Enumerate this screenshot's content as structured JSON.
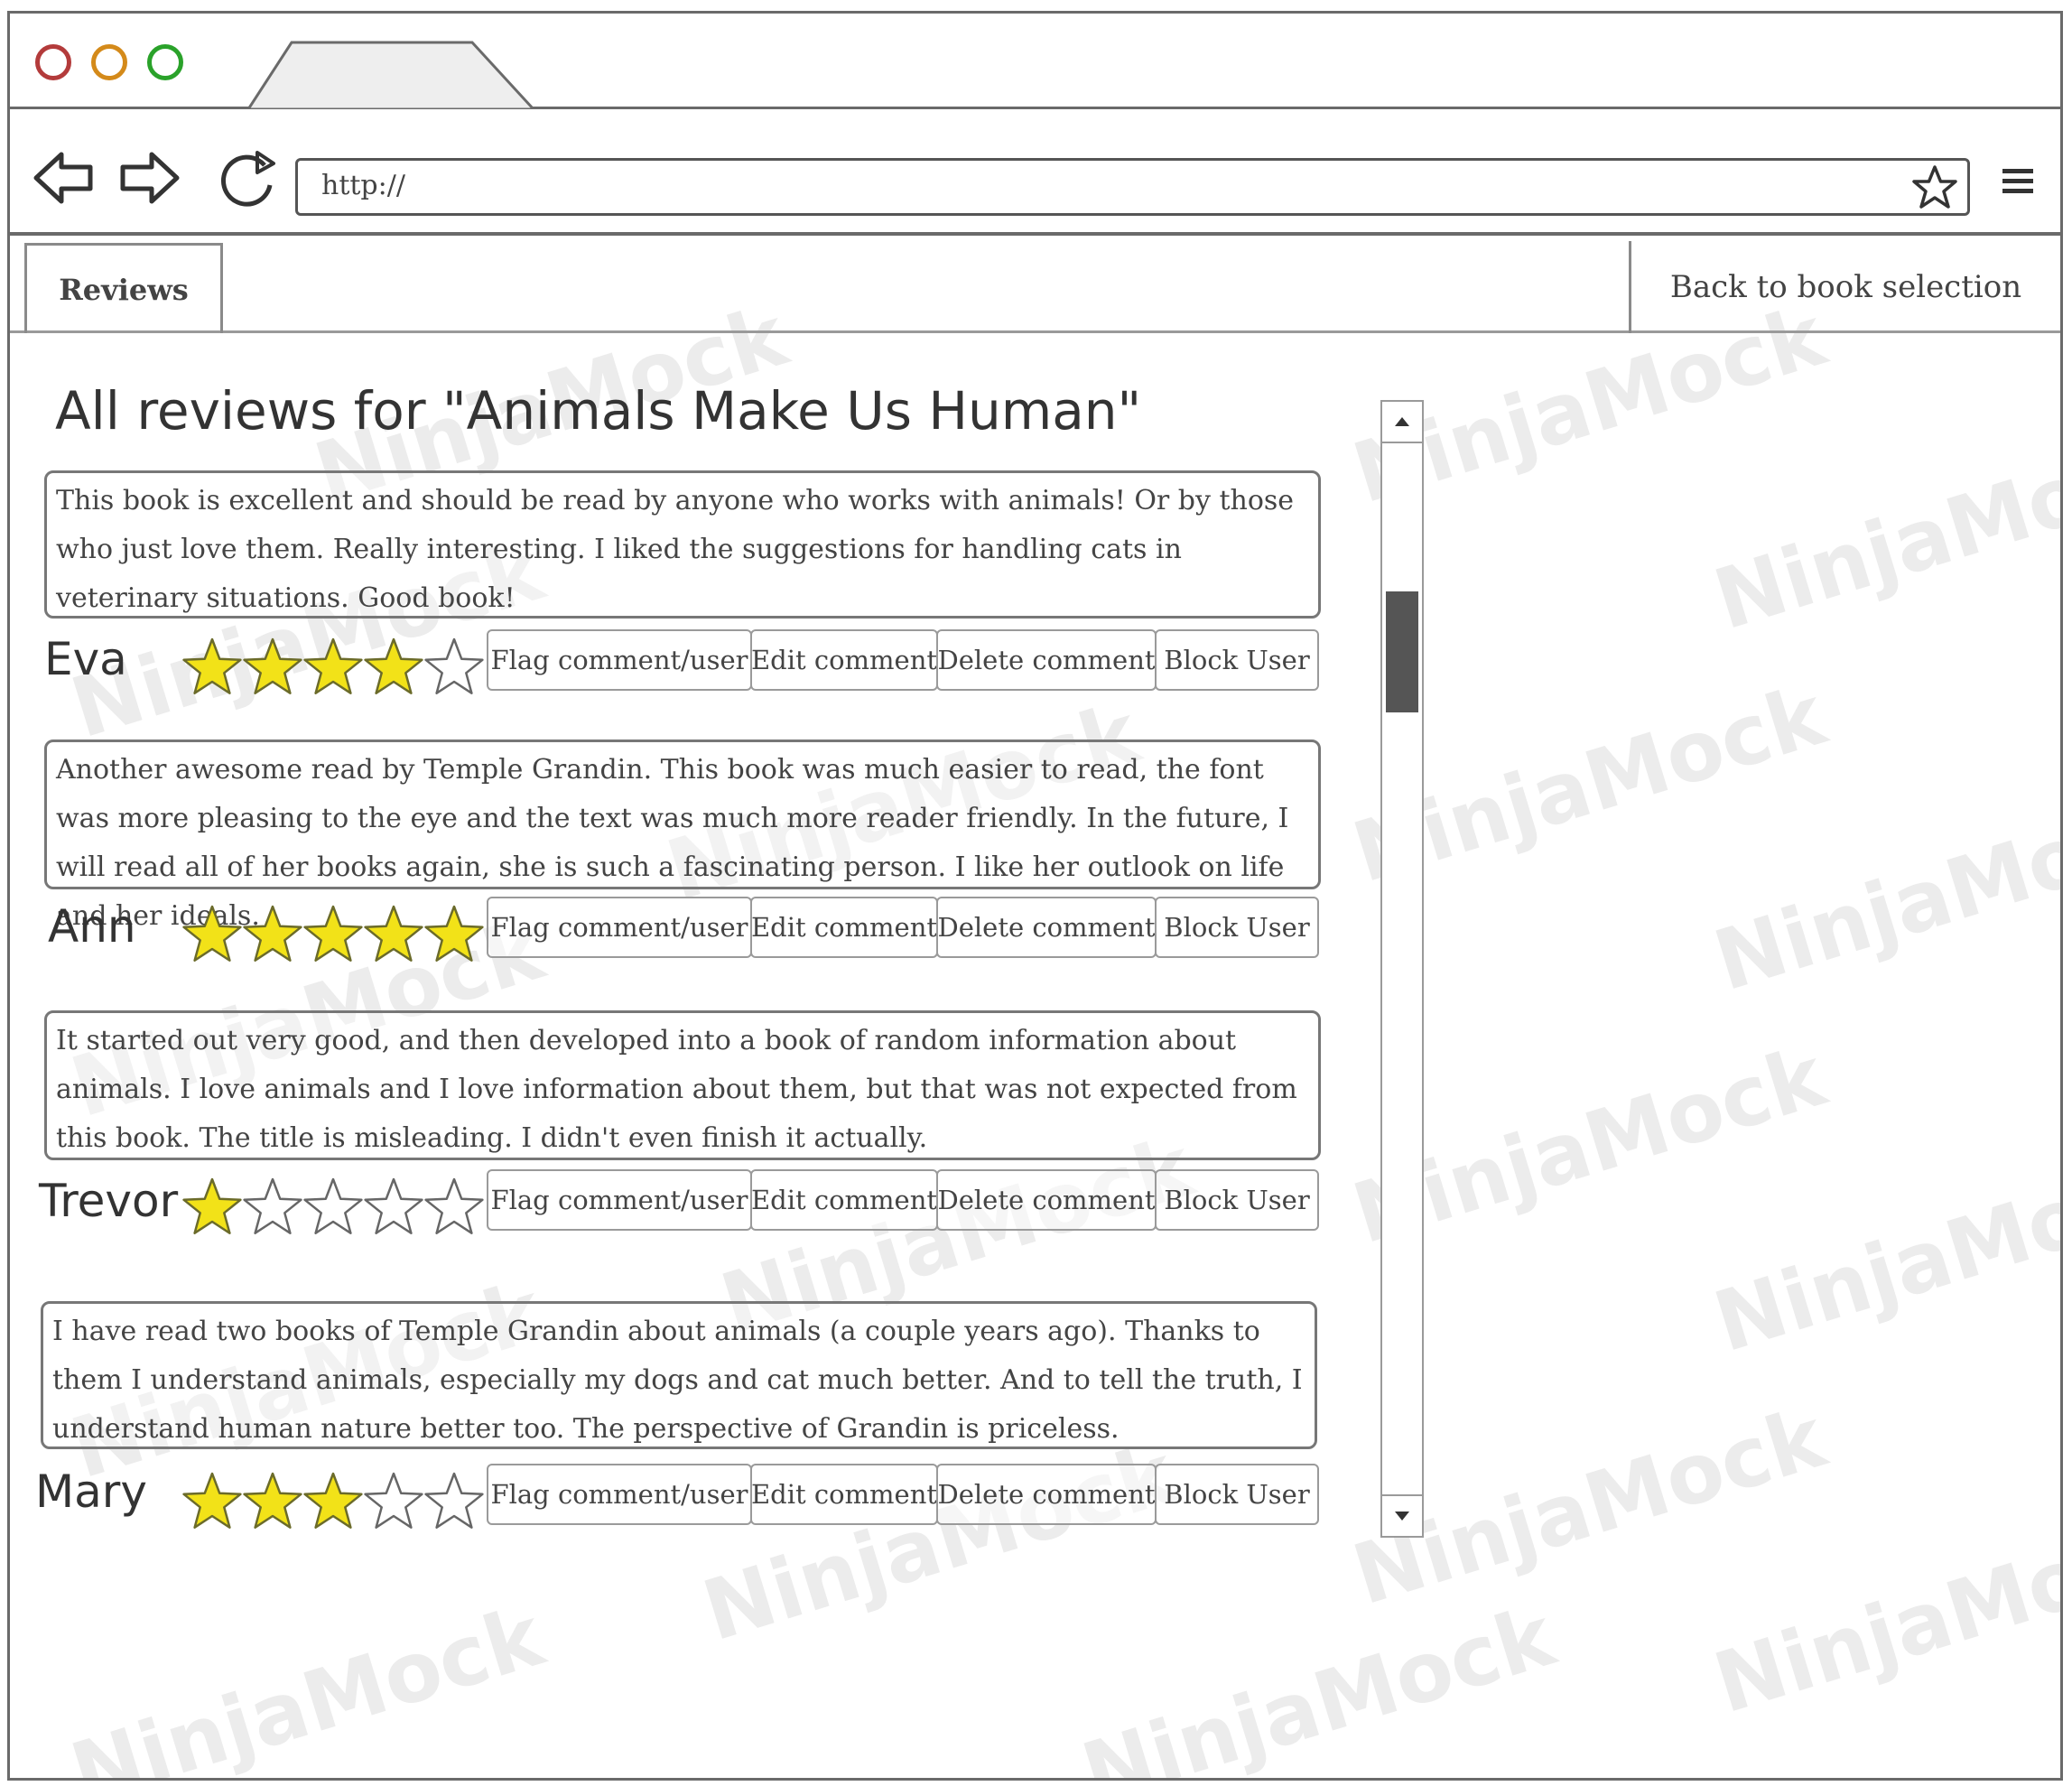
{
  "browser": {
    "tab_label": "",
    "url": "http://",
    "window_controls": {
      "close_color": "#b33b3b",
      "minimize_color": "#d48a1a",
      "maximize_color": "#2aa22a"
    },
    "icons": {
      "back": "back-arrow-icon",
      "forward": "forward-arrow-icon",
      "reload": "reload-icon",
      "bookmark": "star-icon",
      "menu": "hamburger-menu-icon"
    }
  },
  "header": {
    "tab_label": "Reviews",
    "back_link": "Back to book selection"
  },
  "page": {
    "title": "All reviews for \"Animals Make Us Human\""
  },
  "actions": {
    "flag": "Flag comment/user",
    "edit": "Edit comment",
    "delete": "Delete comment",
    "block": "Block User"
  },
  "reviews": [
    {
      "text": "This book is excellent and should be read by anyone who works with animals! Or by those who just love them. Really interesting. I liked the suggestions for handling cats in veterinary situations. Good book!",
      "reviewer": "Eva",
      "rating": 4,
      "max_rating": 5
    },
    {
      "text": "Another awesome read by Temple Grandin. This book was much easier to read, the font was more pleasing to the eye and the text was much more reader friendly. In the future, I will read all of her books again, she is such a fascinating person. I like her outlook on life and her ideals.",
      "reviewer": "Ann",
      "rating": 5,
      "max_rating": 5
    },
    {
      "text": "It started out very good, and then developed into a book of random information about animals. I love animals and I love information about them, but that was not expected from this book. The title is misleading. I didn't even finish it actually.",
      "reviewer": "Trevor",
      "rating": 1,
      "max_rating": 5
    },
    {
      "text": "I have read two books of Temple Grandin about animals (a couple years ago). Thanks to them I understand animals, especially my dogs and cat much better. And to tell the truth, I understand human nature better too. The perspective of Grandin is priceless.",
      "reviewer": "Mary",
      "rating": 3,
      "max_rating": 5
    }
  ],
  "watermark": "NinjaMock",
  "colors": {
    "star_fill": "#f2e218",
    "star_stroke": "#6b6b2a",
    "border": "#6a6a6a"
  }
}
